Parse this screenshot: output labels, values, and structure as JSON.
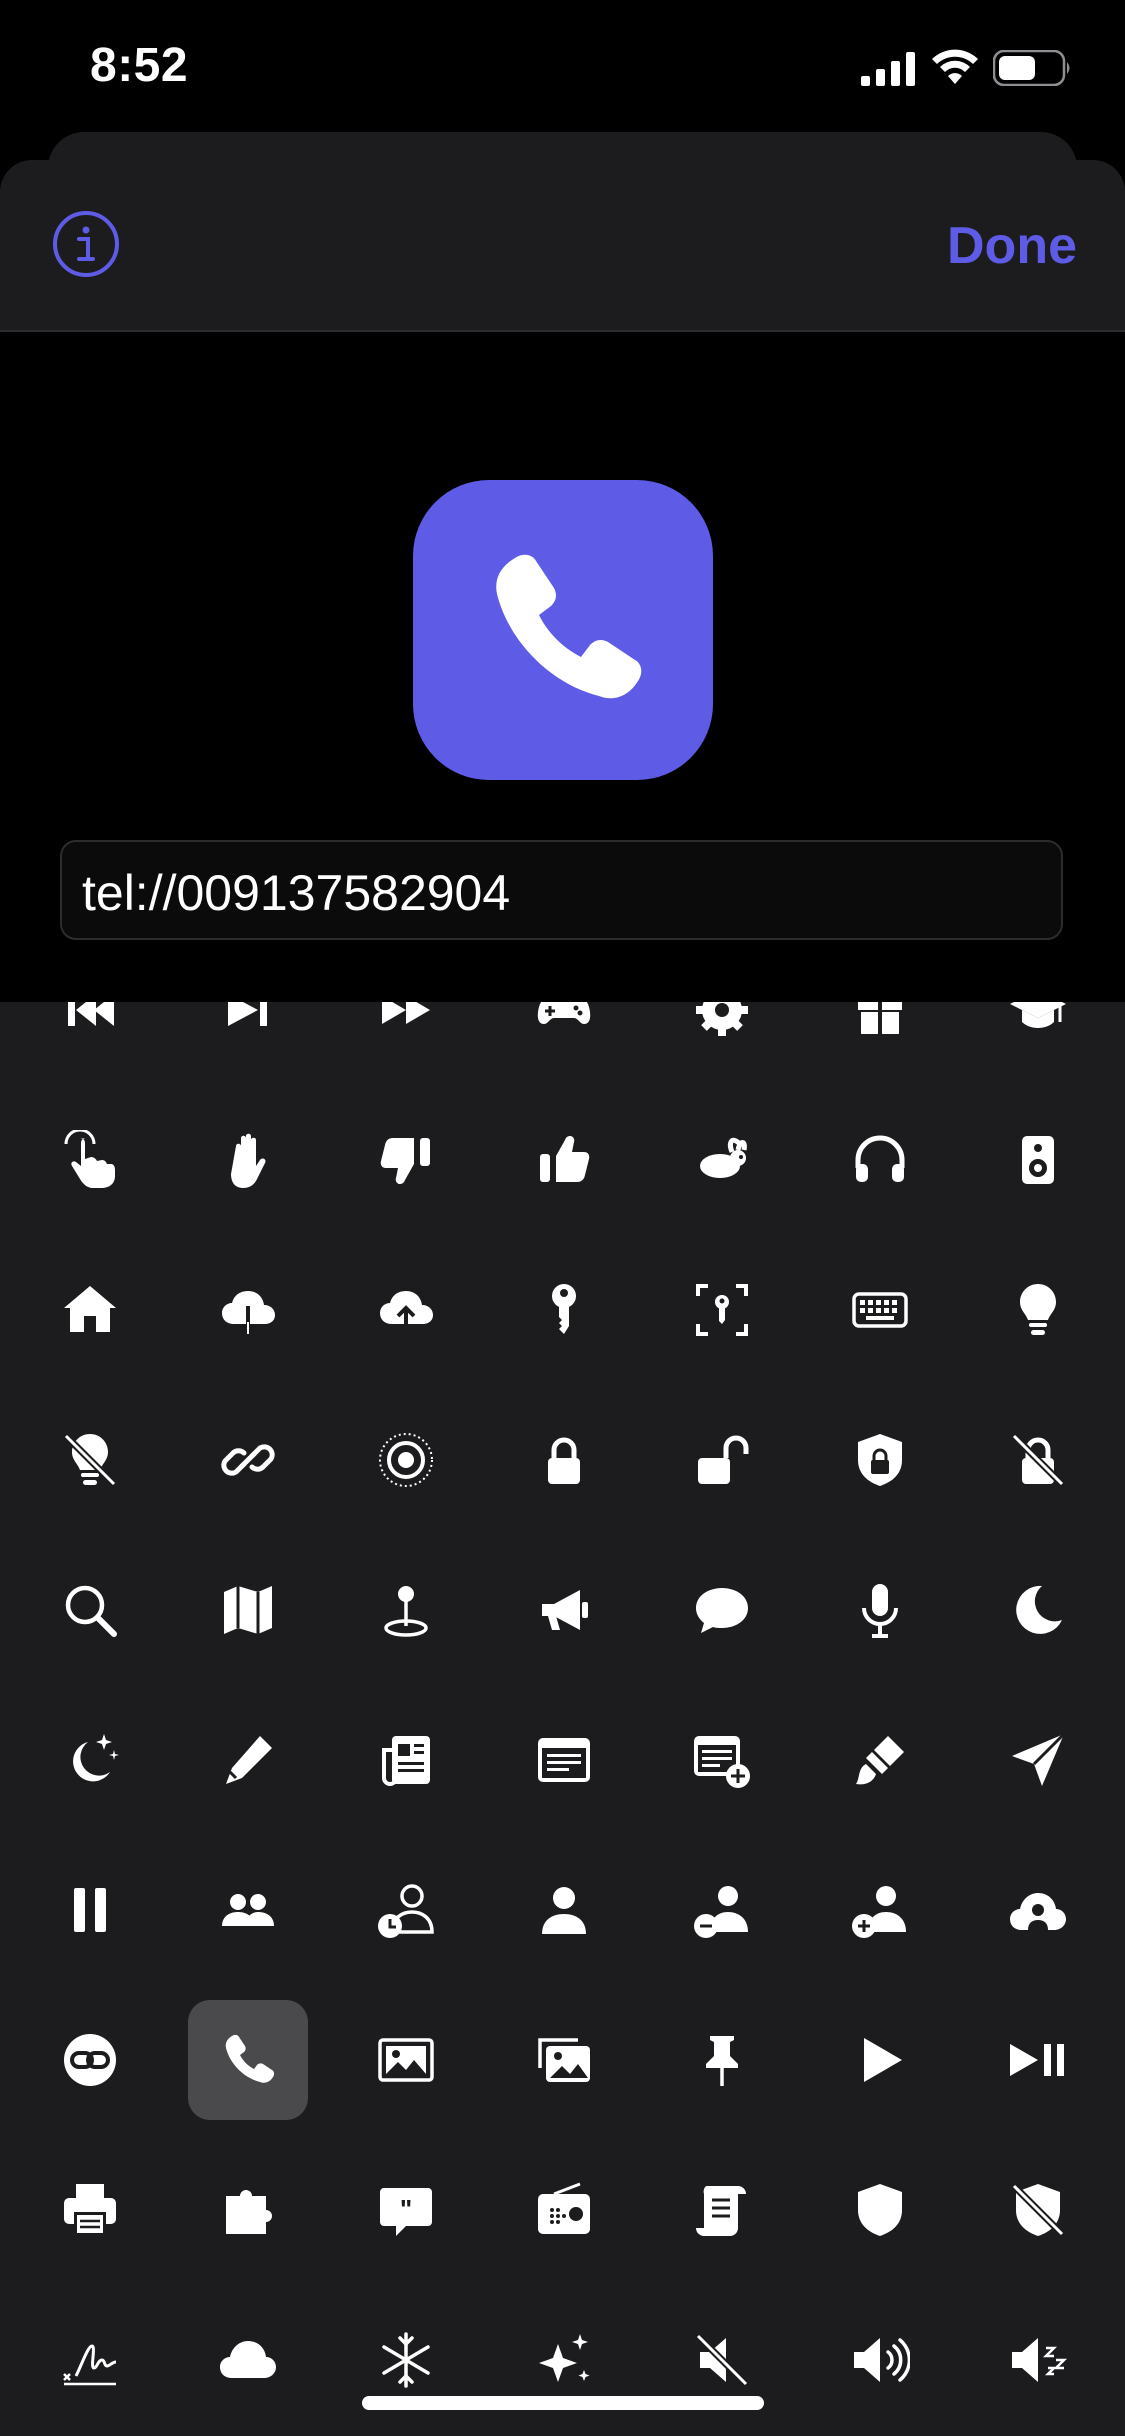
{
  "status_bar": {
    "time": "8:52"
  },
  "nav": {
    "done_label": "Done",
    "info_icon": "info-circle-icon"
  },
  "preview": {
    "icon": "phone-icon",
    "color": "#5e5ce6"
  },
  "url_field": {
    "value": "tel://009137582904"
  },
  "accent": "#5e5ce6",
  "icon_grid": {
    "selected": "phone-icon",
    "icons": [
      "backward-end-icon",
      "forward-end-icon",
      "forward-icon",
      "gamecontroller-icon",
      "gear-icon",
      "gift-icon",
      "graduationcap-icon",
      "hand-point-icon",
      "hand-raised-icon",
      "hand-thumbsdown-icon",
      "hand-thumbsup-icon",
      "hare-icon",
      "headphones-icon",
      "hifispeaker-icon",
      "house-icon",
      "icloud-download-icon",
      "icloud-upload-icon",
      "key-icon",
      "key-viewfinder-icon",
      "keyboard-icon",
      "lightbulb-icon",
      "lightbulb-slash-icon",
      "link-icon",
      "target-icon",
      "lock-icon",
      "lock-open-icon",
      "lock-shield-icon",
      "lock-slash-icon",
      "magnifyingglass-icon",
      "map-icon",
      "mappin-icon",
      "megaphone-icon",
      "message-icon",
      "mic-icon",
      "moon-icon",
      "moon-stars-icon",
      "pencil-icon",
      "newspaper-icon",
      "note-text-icon",
      "note-text-add-icon",
      "paintbrush-icon",
      "paperplane-icon",
      "pause-icon",
      "person-2-icon",
      "person-clock-icon",
      "person-icon",
      "person-minus-icon",
      "person-plus-icon",
      "person-cloud-icon",
      "link-circle-icon",
      "phone-icon",
      "photo-icon",
      "photo-stack-icon",
      "pin-icon",
      "play-icon",
      "playpause-icon",
      "printer-icon",
      "puzzle-icon",
      "quote-bubble-icon",
      "radio-icon",
      "scroll-icon",
      "shield-icon",
      "shield-slash-icon",
      "signature-icon",
      "cloud-icon",
      "snowflake-icon",
      "sparkles-icon",
      "speaker-slash-icon",
      "speaker-wave-icon",
      "speaker-zzz-icon"
    ]
  }
}
